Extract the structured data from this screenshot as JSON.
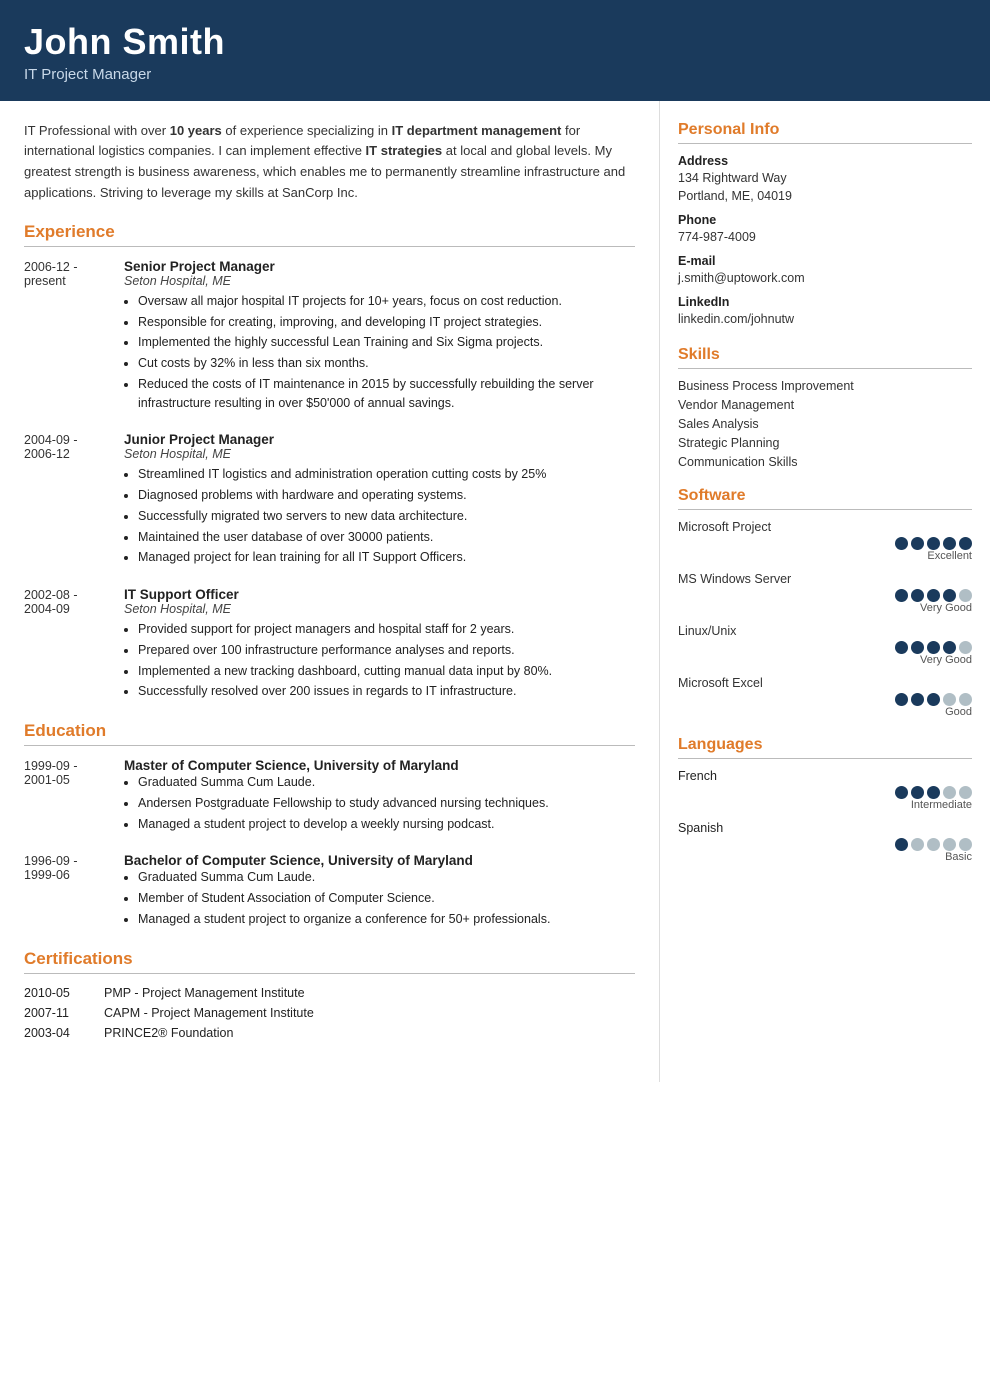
{
  "header": {
    "name": "John Smith",
    "title": "IT Project Manager"
  },
  "summary": {
    "text_parts": [
      "IT Professional with over ",
      "10 years",
      " of experience specializing in ",
      "IT department management",
      " for international logistics companies. I can implement effective ",
      "IT strategies",
      " at local and global levels. My greatest strength is business awareness, which enables me to permanently streamline infrastructure and applications. Striving to leverage my skills at SanCorp Inc."
    ]
  },
  "experience": {
    "section_label": "Experience",
    "entries": [
      {
        "date": "2006-12 -\npresent",
        "title": "Senior Project Manager",
        "org": "Seton Hospital, ME",
        "bullets": [
          "Oversaw all major hospital IT projects for 10+ years, focus on cost reduction.",
          "Responsible for creating, improving, and developing IT project strategies.",
          "Implemented the highly successful Lean Training and Six Sigma projects.",
          "Cut costs by 32% in less than six months.",
          "Reduced the costs of IT maintenance in 2015 by successfully rebuilding the server infrastructure resulting in over $50'000 of annual savings."
        ]
      },
      {
        "date": "2004-09 -\n2006-12",
        "title": "Junior Project Manager",
        "org": "Seton Hospital, ME",
        "bullets": [
          "Streamlined IT logistics and administration operation cutting costs by 25%",
          "Diagnosed problems with hardware and operating systems.",
          "Successfully migrated two servers to new data architecture.",
          "Maintained the user database of over 30000 patients.",
          "Managed project for lean training for all IT Support Officers."
        ]
      },
      {
        "date": "2002-08 -\n2004-09",
        "title": "IT Support Officer",
        "org": "Seton Hospital, ME",
        "bullets": [
          "Provided support for project managers and hospital staff for 2 years.",
          "Prepared over 100 infrastructure performance analyses and reports.",
          "Implemented a new tracking dashboard, cutting manual data input by 80%.",
          "Successfully resolved over 200 issues in regards to IT infrastructure."
        ]
      }
    ]
  },
  "education": {
    "section_label": "Education",
    "entries": [
      {
        "date": "1999-09 -\n2001-05",
        "title": "Master of Computer Science, University of Maryland",
        "org": "",
        "bullets": [
          "Graduated Summa Cum Laude.",
          "Andersen Postgraduate Fellowship to study advanced nursing techniques.",
          "Managed a student project to develop a weekly nursing podcast."
        ]
      },
      {
        "date": "1996-09 -\n1999-06",
        "title": "Bachelor of Computer Science, University of Maryland",
        "org": "",
        "bullets": [
          "Graduated Summa Cum Laude.",
          "Member of Student Association of Computer Science.",
          "Managed a student project to organize a conference for 50+ professionals."
        ]
      }
    ]
  },
  "certifications": {
    "section_label": "Certifications",
    "entries": [
      {
        "date": "2010-05",
        "text": "PMP - Project Management Institute"
      },
      {
        "date": "2007-11",
        "text": "CAPM - Project Management Institute"
      },
      {
        "date": "2003-04",
        "text": "PRINCE2® Foundation"
      }
    ]
  },
  "personal_info": {
    "section_label": "Personal Info",
    "fields": [
      {
        "label": "Address",
        "value": "134 Rightward Way\nPortland, ME, 04019"
      },
      {
        "label": "Phone",
        "value": "774-987-4009"
      },
      {
        "label": "E-mail",
        "value": "j.smith@uptowork.com"
      },
      {
        "label": "LinkedIn",
        "value": "linkedin.com/johnutw"
      }
    ]
  },
  "skills": {
    "section_label": "Skills",
    "items": [
      "Business Process Improvement",
      "Vendor Management",
      "Sales Analysis",
      "Strategic Planning",
      "Communication Skills"
    ]
  },
  "software": {
    "section_label": "Software",
    "items": [
      {
        "name": "Microsoft Project",
        "filled": 5,
        "total": 5,
        "label": "Excellent"
      },
      {
        "name": "MS Windows Server",
        "filled": 4,
        "total": 5,
        "label": "Very Good"
      },
      {
        "name": "Linux/Unix",
        "filled": 4,
        "total": 5,
        "label": "Very Good"
      },
      {
        "name": "Microsoft Excel",
        "filled": 3,
        "total": 5,
        "label": "Good"
      }
    ]
  },
  "languages": {
    "section_label": "Languages",
    "items": [
      {
        "name": "French",
        "filled": 3,
        "total": 5,
        "label": "Intermediate"
      },
      {
        "name": "Spanish",
        "filled": 1,
        "total": 5,
        "label": "Basic"
      }
    ]
  }
}
